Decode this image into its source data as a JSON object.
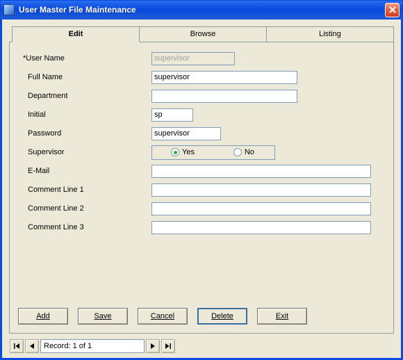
{
  "window": {
    "title": "User Master File Maintenance"
  },
  "tabs": {
    "edit": "Edit",
    "browse": "Browse",
    "listing": "Listing"
  },
  "labels": {
    "user_name": "User Name",
    "full_name": "Full Name",
    "department": "Department",
    "initial": "Initial",
    "password": "Password",
    "supervisor": "Supervisor",
    "email": "E-Mail",
    "comment1": "Comment Line 1",
    "comment2": "Comment Line 2",
    "comment3": "Comment Line 3"
  },
  "fields": {
    "user_name": "supervisor",
    "full_name": "supervisor",
    "department": "",
    "initial": "sp",
    "password": "supervisor",
    "supervisor": "Yes",
    "email": "",
    "comment1": "",
    "comment2": "",
    "comment3": ""
  },
  "radio": {
    "yes": "Yes",
    "no": "No"
  },
  "buttons": {
    "add": "Add",
    "save": "Save",
    "cancel": "Cancel",
    "delete": "Delete",
    "exit": "Exit"
  },
  "recordnav": {
    "status": "Record: 1 of 1"
  }
}
